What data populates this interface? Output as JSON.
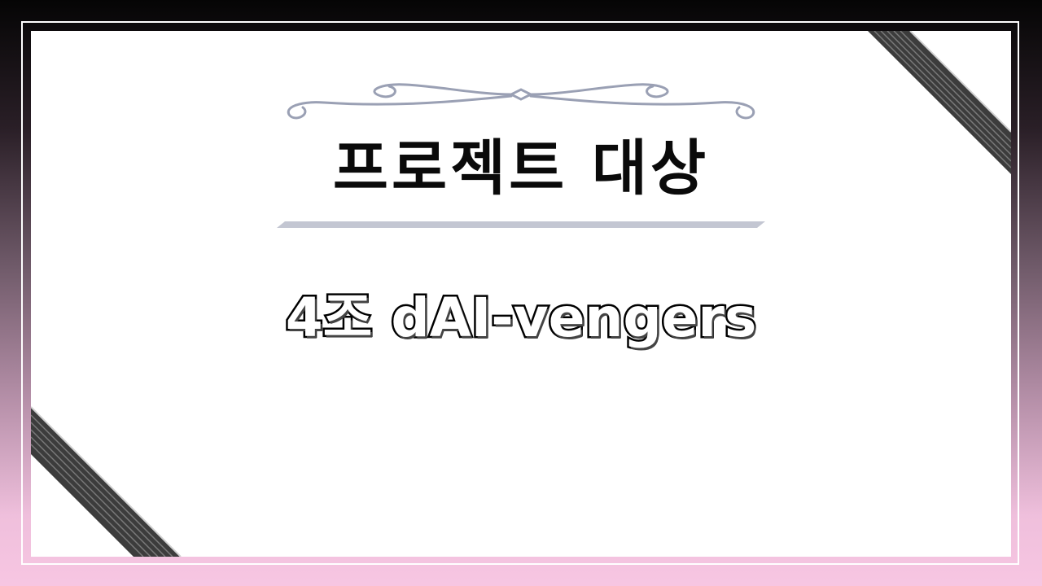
{
  "slide": {
    "title": "프로젝트 대상",
    "subtitle": "4조 dAI-vengers"
  },
  "colors": {
    "title": "#0a0a0a",
    "subtitle_fill": "#ffffff",
    "subtitle_stroke": "#000000",
    "ornament": "#9aa0b4",
    "underline": "#c3c6d2",
    "ribbon": "#3a3a3a",
    "background_top": "#050505",
    "background_bottom": "#f7c6e2"
  },
  "icons": [
    "corner-ribbon-top-right",
    "corner-ribbon-bottom-left",
    "flourish-divider"
  ]
}
